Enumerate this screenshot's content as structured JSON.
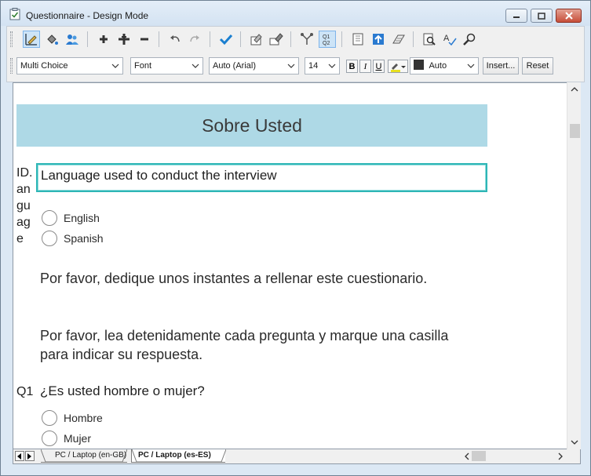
{
  "window": {
    "title": "Questionnaire - Design Mode",
    "icon": "clipboard-icon"
  },
  "toolbar_icons": [
    "design-mode-icon",
    "fill-color-icon",
    "respondents-icon",
    "add-icon",
    "add-multiple-icon",
    "remove-icon",
    "undo-icon",
    "redo-icon",
    "check-icon",
    "properties-icon",
    "publish-icon",
    "routing-icon",
    "numbering-icon",
    "layout-icon",
    "upload-icon",
    "styles-icon",
    "preview-icon",
    "spellcheck-icon",
    "find-icon"
  ],
  "format_bar": {
    "question_type": "Multi Choice",
    "font_selector": "Font",
    "font_name": "Auto (Arial)",
    "font_size": "14",
    "bold_label": "B",
    "italic_label": "I",
    "underline_label": "U",
    "color_value": "Auto",
    "insert_label": "Insert...",
    "reset_label": "Reset"
  },
  "questionnaire": {
    "section_title": "Sobre Usted",
    "q_language": {
      "id": "ID.language",
      "id_lines": [
        "ID.",
        "an",
        "gu",
        "ag",
        "e"
      ],
      "text": "Language used to conduct the interview",
      "options": [
        "English",
        "Spanish"
      ]
    },
    "intro_1": "Por favor, dedique unos instantes a rellenar este cuestionario.",
    "intro_2": "Por favor, lea detenidamente cada pregunta y marque una casilla para indicar su respuesta.",
    "q1": {
      "id": "Q1",
      "text": "¿Es usted hombre o mujer?",
      "options": [
        "Hombre",
        "Mujer"
      ]
    }
  },
  "tabs": [
    {
      "label": "PC / Laptop (en-GB)",
      "active": false
    },
    {
      "label": "PC / Laptop (es-ES)",
      "active": true
    }
  ],
  "colors": {
    "banner": "#aed9e6",
    "selection_border": "#2eb6b6"
  }
}
